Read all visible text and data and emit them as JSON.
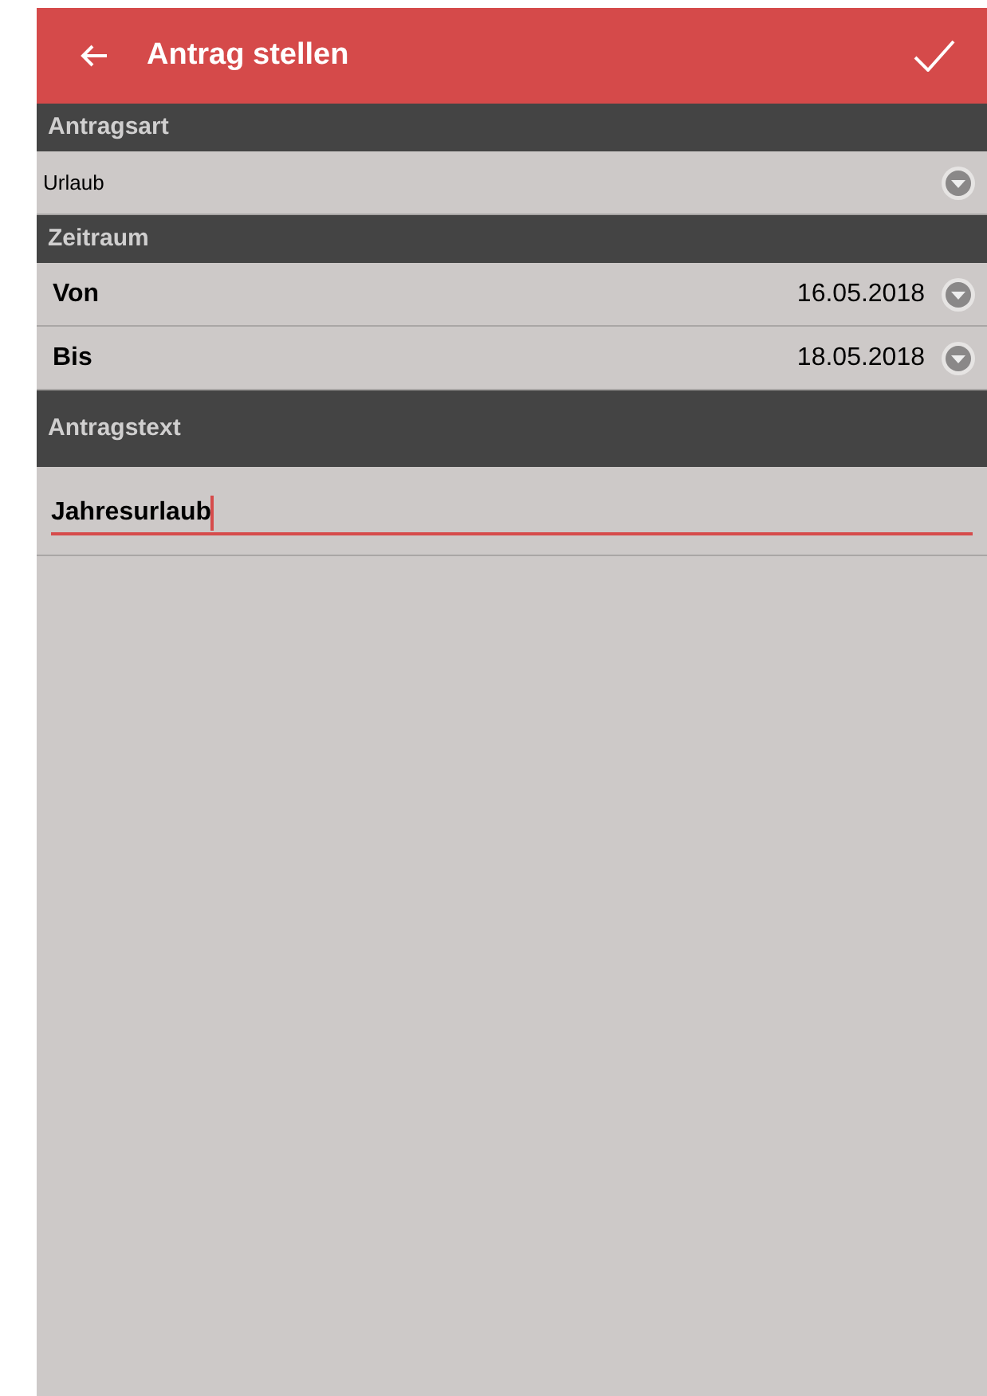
{
  "app_bar": {
    "title": "Antrag stellen"
  },
  "sections": [
    {
      "title": "Antragsart",
      "rows": [
        {
          "kind": "select",
          "value": "Urlaub"
        }
      ]
    },
    {
      "title": "Zeitraum",
      "rows": [
        {
          "kind": "date",
          "label": "Von",
          "value": "16.05.2018"
        },
        {
          "kind": "date",
          "label": "Bis",
          "value": "18.05.2018"
        }
      ]
    },
    {
      "title": "Antragstext",
      "rows": [
        {
          "kind": "text",
          "value": "Jahresurlaub",
          "focused": true
        }
      ]
    }
  ]
}
